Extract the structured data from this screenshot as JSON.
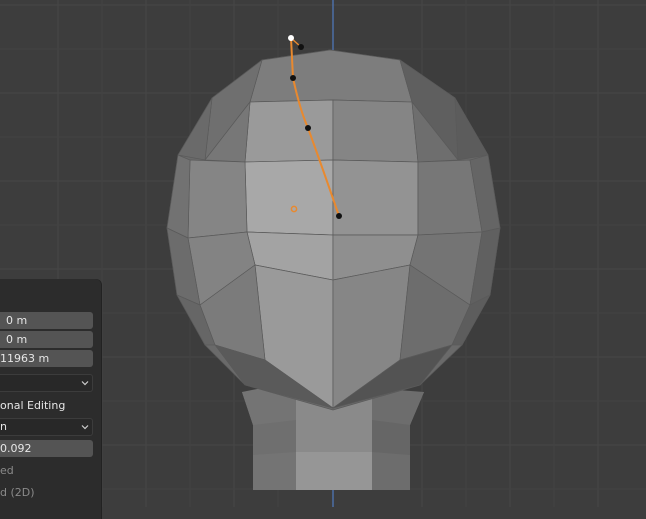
{
  "redo_panel": {
    "location_y": "0 m",
    "location_z": "0 m",
    "location_extra": "11963 m",
    "proportional_editing_label": "onal Editing",
    "falloff_value": "n",
    "size_value": "0.092",
    "connected_label": "ed",
    "projected_label": "d (2D)"
  },
  "colors": {
    "background": "#3d3d3d",
    "grid_line": "#494949",
    "axis_blue": "#4d6ea6",
    "curve_orange": "#e8892f",
    "panel_bg": "#2c2c2c",
    "field_bg": "#545454"
  },
  "icons": {
    "dropdown": "chevron-down-icon",
    "object_origin": "origin-point-icon"
  }
}
